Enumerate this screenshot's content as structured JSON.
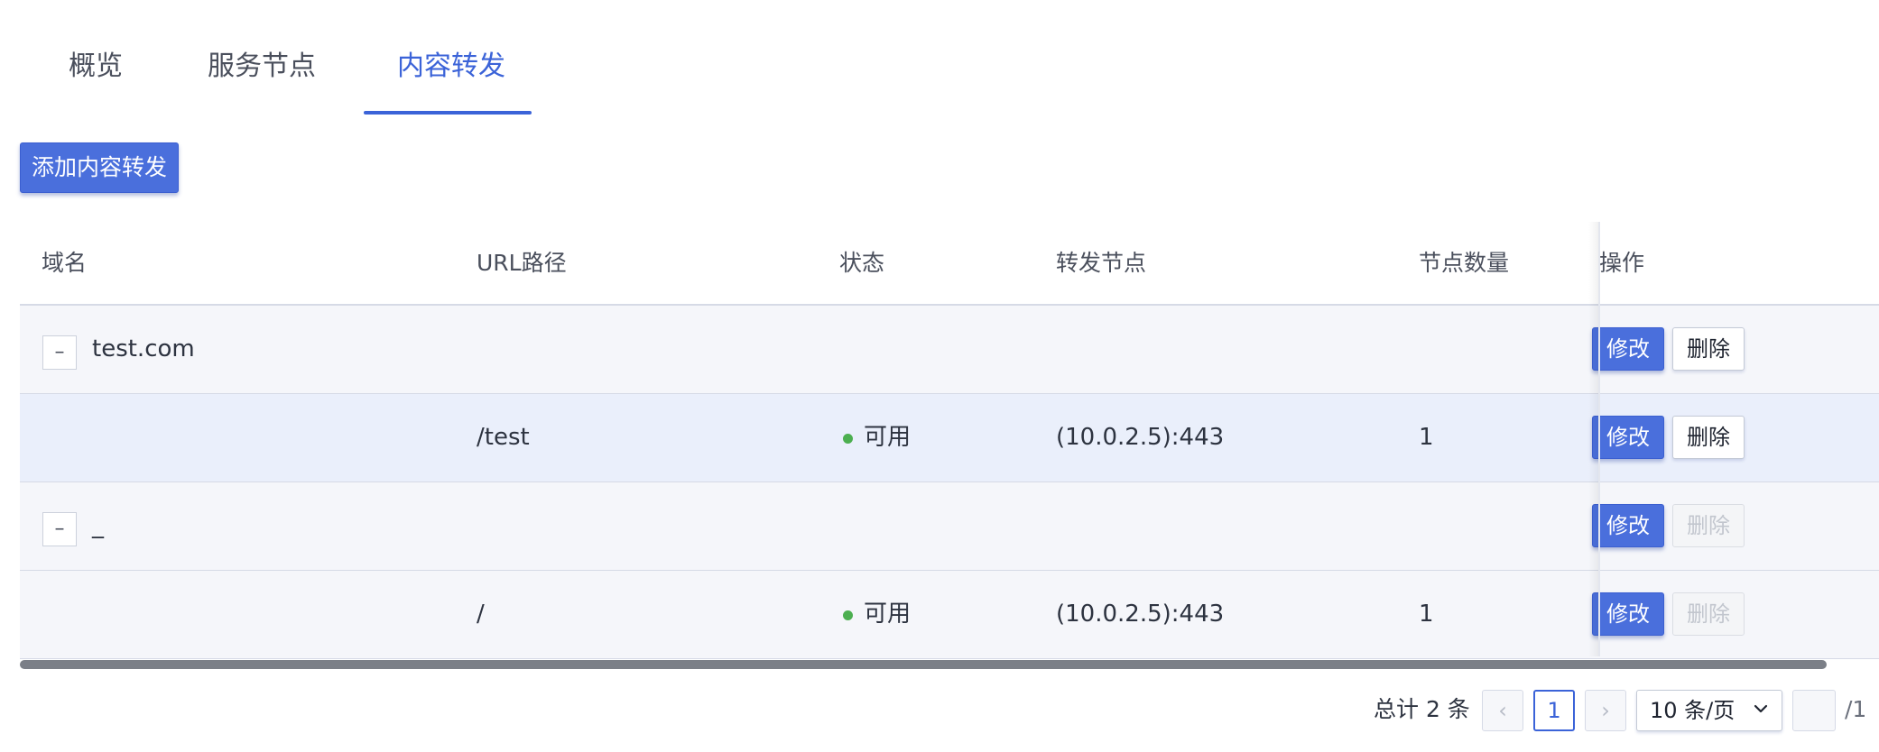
{
  "tabs": [
    {
      "label": "概览",
      "active": false
    },
    {
      "label": "服务节点",
      "active": false
    },
    {
      "label": "内容转发",
      "active": true
    }
  ],
  "toolbar": {
    "add_label": "添加内容转发"
  },
  "table": {
    "columns": [
      "域名",
      "URL路径",
      "状态",
      "转发节点",
      "节点数量",
      "操作"
    ],
    "rows": [
      {
        "toggle": "–",
        "domain": "test.com",
        "path": "",
        "status": "",
        "node": "",
        "count": "",
        "edit_label": "修改",
        "delete_label": "删除",
        "delete_enabled": true
      },
      {
        "toggle": "",
        "domain": "",
        "path": "/test",
        "status": "可用",
        "node": "(10.0.2.5):443",
        "count": "1",
        "edit_label": "修改",
        "delete_label": "删除",
        "delete_enabled": true
      },
      {
        "toggle": "–",
        "domain": "_",
        "path": "",
        "status": "",
        "node": "",
        "count": "",
        "edit_label": "修改",
        "delete_label": "删除",
        "delete_enabled": false
      },
      {
        "toggle": "",
        "domain": "",
        "path": "/",
        "status": "可用",
        "node": "(10.0.2.5):443",
        "count": "1",
        "edit_label": "修改",
        "delete_label": "删除",
        "delete_enabled": false
      }
    ]
  },
  "pagination": {
    "total_text": "总计 2 条",
    "prev_icon": "‹",
    "current_page": "1",
    "next_icon": "›",
    "page_size": "10 条/页",
    "page_total": "/1"
  },
  "colors": {
    "accent": "#3b63d8",
    "primary_button": "#4a6fdc",
    "status_ok": "#4caf50"
  }
}
